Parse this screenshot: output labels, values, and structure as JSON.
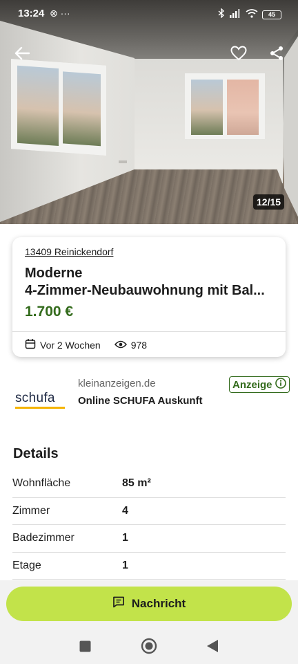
{
  "statusbar": {
    "time": "13:24",
    "left_icons": "⊗ ···",
    "battery": "45"
  },
  "photo": {
    "counter": "12/15",
    "icons": [
      "back-arrow-icon",
      "heart-icon",
      "share-icon"
    ]
  },
  "listing": {
    "location": "13409 Reinickendorf",
    "title_line1": "Moderne",
    "title_line2": "4-Zimmer-Neubauwohnung mit Bal...",
    "price": "1.700 €",
    "posted": "Vor 2 Wochen",
    "views": "978"
  },
  "ad": {
    "logo_text": "schufa",
    "source": "kleinanzeigen.de",
    "title": "Online SCHUFA Auskunft",
    "badge": "Anzeige"
  },
  "details": {
    "heading": "Details",
    "rows": [
      {
        "label": "Wohnfläche",
        "value": "85 m²"
      },
      {
        "label": "Zimmer",
        "value": "4"
      },
      {
        "label": "Badezimmer",
        "value": "1"
      },
      {
        "label": "Etage",
        "value": "1"
      }
    ]
  },
  "actions": {
    "message_label": "Nachricht"
  },
  "colors": {
    "price": "#336b1c",
    "message_button": "#c2e34a",
    "badge": "#336b1c"
  }
}
